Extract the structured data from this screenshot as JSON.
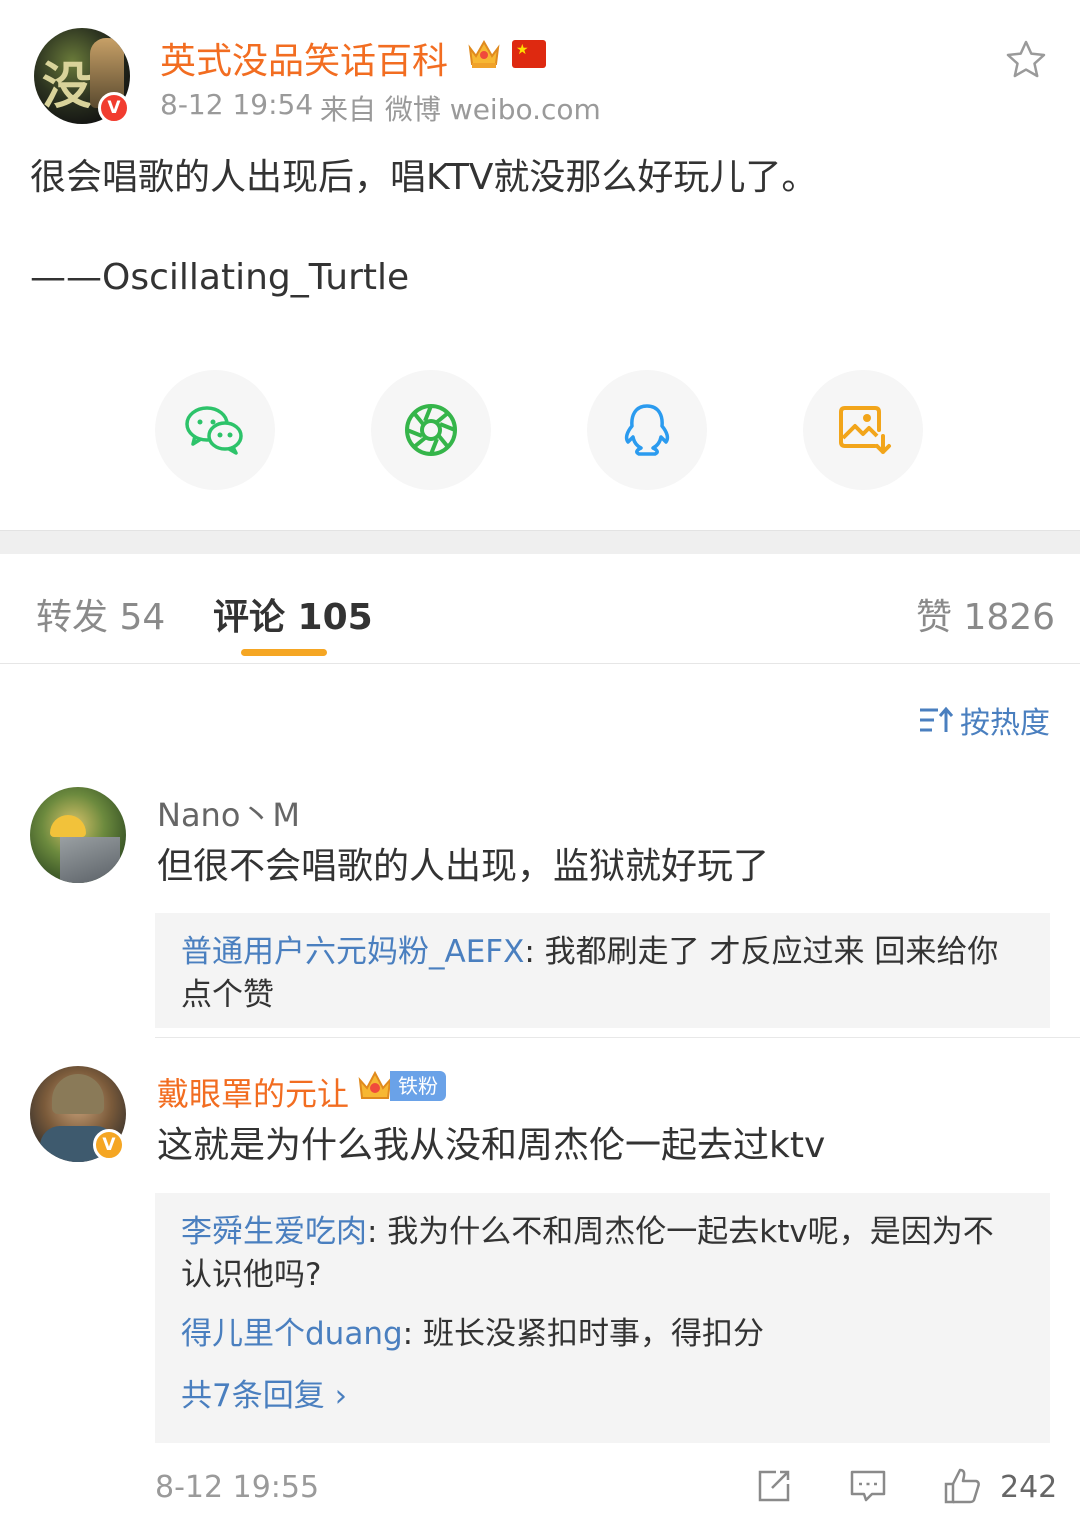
{
  "post": {
    "author": "英式没品笑话百科",
    "time": "8-12 19:54",
    "source": "来自 微博 weibo.com",
    "text": "很会唱歌的人出现后，唱KTV就没那么好玩儿了。",
    "attribution": "——Oscillating_Turtle",
    "avatar_glyph": "没"
  },
  "share": [
    "wechat-icon",
    "moments-icon",
    "qq-icon",
    "save-image-icon"
  ],
  "tabs": {
    "repost": "转发 54",
    "comment": "评论 105",
    "like": "赞 1826"
  },
  "sort": {
    "label": "按热度"
  },
  "comments": [
    {
      "name": "Nano丶M",
      "text": "但很不会唱歌的人出现，监狱就好玩了",
      "replies": [
        {
          "name": "普通用户六元妈粉_AEFX",
          "text": ": 我都刷走了 才反应过来 回来给你",
          "text2": "点个赞"
        }
      ]
    },
    {
      "name": "戴眼罩的元让",
      "badge": "铁粉",
      "text": "这就是为什么我从没和周杰伦一起去过ktv",
      "replies": [
        {
          "name": "李舜生爱吃肉",
          "text": ": 我为什么不和周杰伦一起去ktv呢，是因为不",
          "text2": "认识他吗?"
        },
        {
          "name": "得儿里个duang",
          "text": ": 班长没紧扣时事，得扣分"
        }
      ],
      "more": "共7条回复 ›",
      "time": "8-12 19:55",
      "likes": "242"
    }
  ],
  "colors": {
    "accent_orange": "#f26d21",
    "link_blue": "#4a7fbf",
    "tab_underline": "#f5a623"
  }
}
